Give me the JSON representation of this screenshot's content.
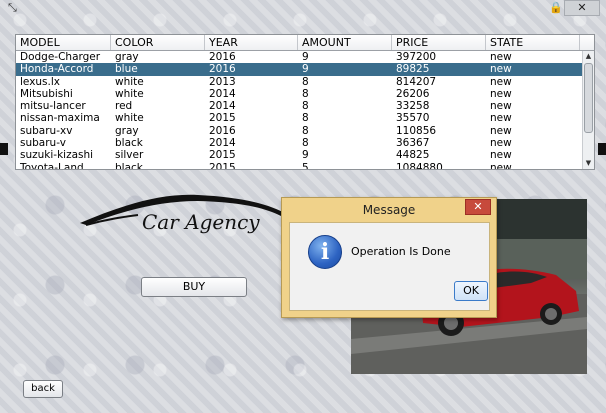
{
  "window": {
    "icons": [
      "resize-icon",
      "lock-icon"
    ],
    "close_label": "✕"
  },
  "table": {
    "columns": [
      "MODEL",
      "COLOR",
      "YEAR",
      "AMOUNT",
      "PRICE",
      "STATE"
    ],
    "rows": [
      [
        "Dodge-Charger",
        "gray",
        "2016",
        "9",
        "397200",
        "new"
      ],
      [
        "Honda-Accord",
        "blue",
        "2016",
        "9",
        "89825",
        "new"
      ],
      [
        "lexus.lx",
        "white",
        "2013",
        "8",
        "814207",
        "new"
      ],
      [
        "Mitsubishi",
        "white",
        "2014",
        "8",
        "26206",
        "new"
      ],
      [
        "mitsu-lancer",
        "red",
        "2014",
        "8",
        "33258",
        "new"
      ],
      [
        "nissan-maxima",
        "white",
        "2015",
        "8",
        "35570",
        "new"
      ],
      [
        "subaru-xv",
        "gray",
        "2016",
        "8",
        "110856",
        "new"
      ],
      [
        "subaru-v",
        "black",
        "2014",
        "8",
        "36367",
        "new"
      ],
      [
        "suzuki-kizashi",
        "silver",
        "2015",
        "9",
        "44825",
        "new"
      ],
      [
        "Toyota-Land",
        "black",
        "2015",
        "5",
        "1084880",
        "new"
      ]
    ],
    "selected_row": 1
  },
  "logo": {
    "text": "Car Agency"
  },
  "buttons": {
    "buy": "BUY",
    "back": "back"
  },
  "dialog": {
    "title": "Message",
    "close": "✕",
    "message": "Operation Is Done",
    "icon_glyph": "i",
    "ok": "OK"
  },
  "colors": {
    "selection": "#3a6d8c",
    "dialog_frame": "#f0d28a",
    "close_button": "#c74a3c",
    "car_body": "#b3141c"
  }
}
